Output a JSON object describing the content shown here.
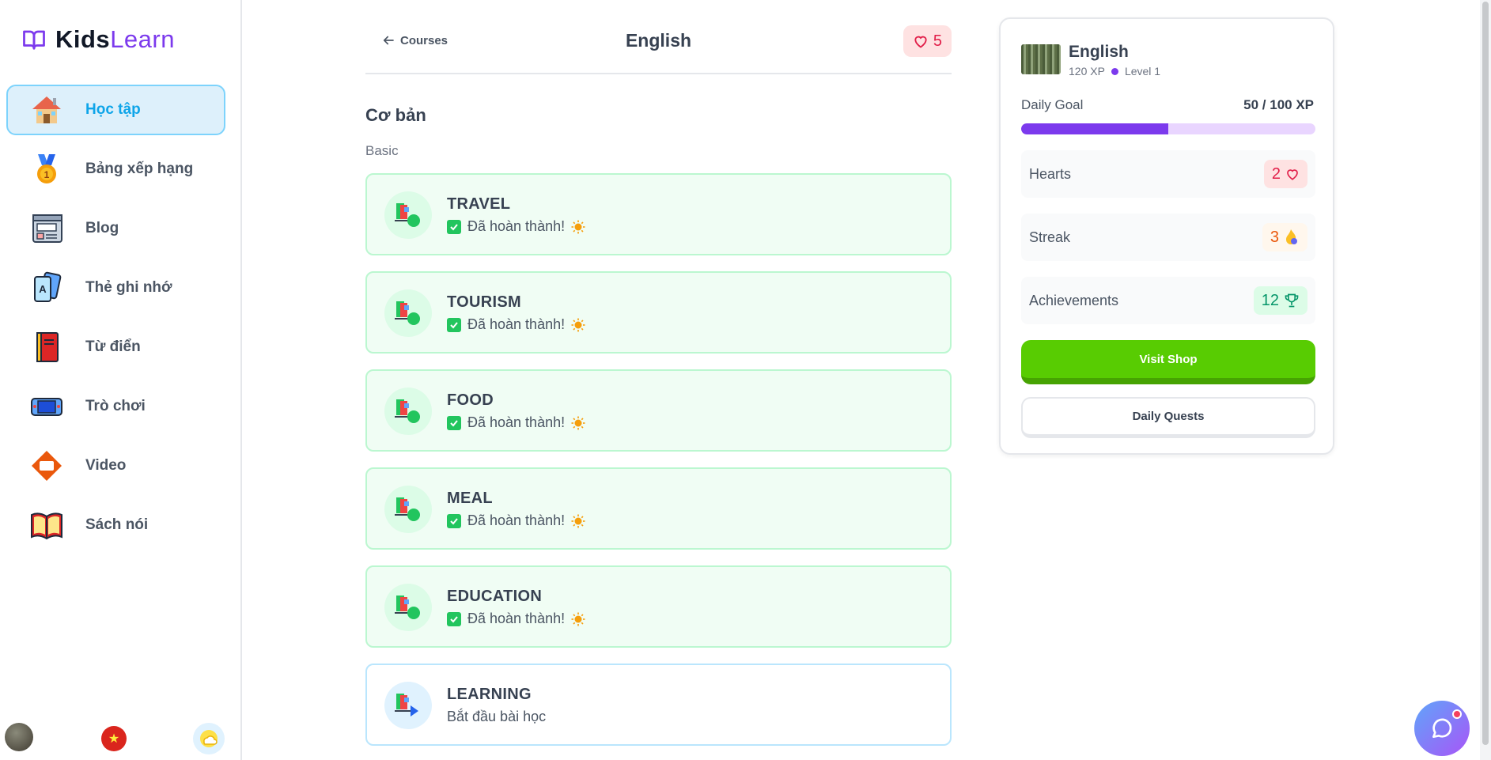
{
  "app": {
    "logo_primary": "Kids",
    "logo_accent": "Learn"
  },
  "sidebar": {
    "items": [
      {
        "label": "Học tập",
        "icon": "house-icon",
        "active": true
      },
      {
        "label": "Bảng xếp hạng",
        "icon": "medal-icon",
        "active": false
      },
      {
        "label": "Blog",
        "icon": "blog-icon",
        "active": false
      },
      {
        "label": "Thẻ ghi nhớ",
        "icon": "flashcard-icon",
        "active": false
      },
      {
        "label": "Từ điển",
        "icon": "dictionary-icon",
        "active": false
      },
      {
        "label": "Trò chơi",
        "icon": "game-icon",
        "active": false
      },
      {
        "label": "Video",
        "icon": "video-icon",
        "active": false
      },
      {
        "label": "Sách nói",
        "icon": "audiobook-icon",
        "active": false
      }
    ],
    "bottom": {
      "avatar_icon": "user-avatar",
      "language_icon": "vietnam-flag-icon",
      "theme_icon": "cloud-sun-icon"
    }
  },
  "header": {
    "back_label": "Courses",
    "title": "English",
    "hearts": "5"
  },
  "section": {
    "title": "Cơ bản",
    "subtitle": "Basic"
  },
  "lessons": [
    {
      "name": "TRAVEL",
      "status": "Đã hoàn thành!",
      "completed": true
    },
    {
      "name": "TOURISM",
      "status": "Đã hoàn thành!",
      "completed": true
    },
    {
      "name": "FOOD",
      "status": "Đã hoàn thành!",
      "completed": true
    },
    {
      "name": "MEAL",
      "status": "Đã hoàn thành!",
      "completed": true
    },
    {
      "name": "EDUCATION",
      "status": "Đã hoàn thành!",
      "completed": true
    },
    {
      "name": "LEARNING",
      "status": "Bắt đầu bài học",
      "completed": false
    }
  ],
  "panel": {
    "course": "English",
    "xp": "120 XP",
    "level": "Level 1",
    "daily_goal_label": "Daily Goal",
    "daily_goal_value": "50 / 100 XP",
    "daily_goal_progress": 0.5,
    "hearts_label": "Hearts",
    "hearts_value": "2",
    "streak_label": "Streak",
    "streak_value": "3",
    "achievements_label": "Achievements",
    "achievements_value": "12",
    "shop_button": "Visit Shop",
    "quests_button": "Daily Quests"
  },
  "colors": {
    "brand": "#7c3aed",
    "active_nav": "#0ea5e9",
    "success": "#22c55e",
    "shop_button": "#58cc02"
  }
}
